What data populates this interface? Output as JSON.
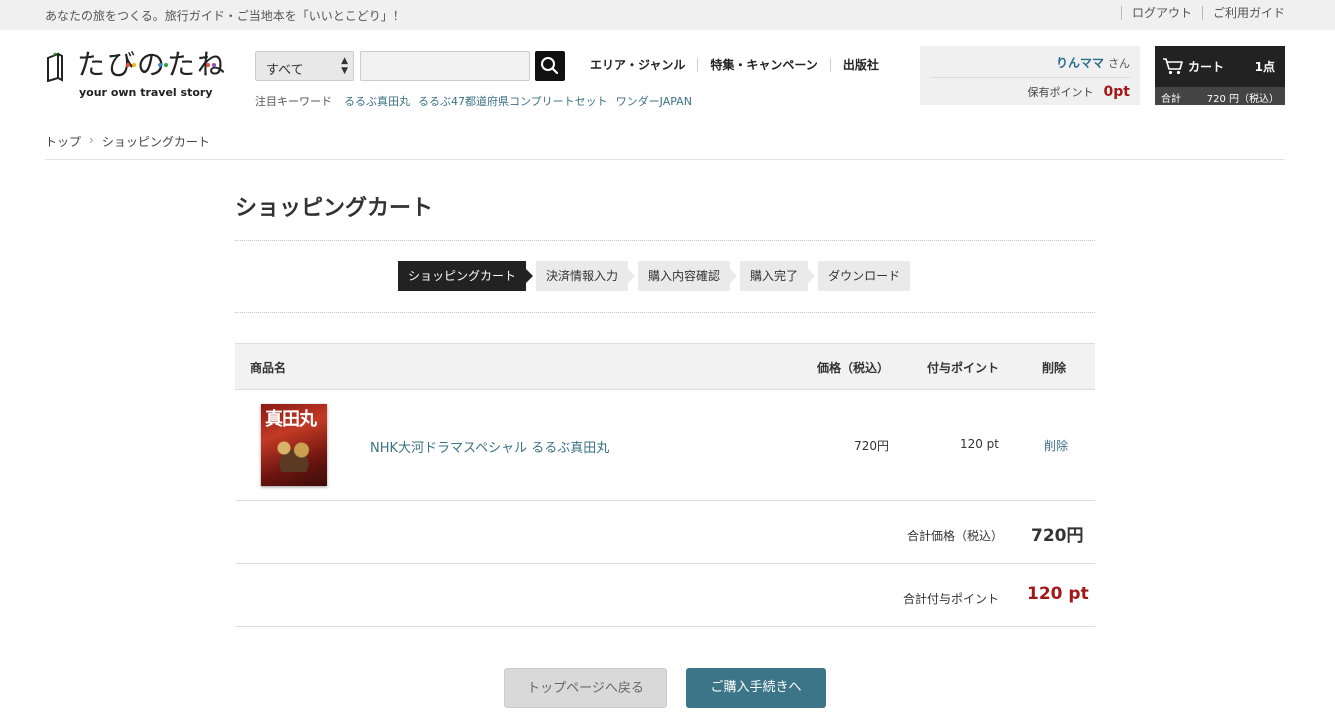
{
  "topbar": {
    "tagline": "あなたの旅をつくる。旅行ガイド・ご当地本を「いいとこどり」！",
    "logout": "ログアウト",
    "guide": "ご利用ガイド"
  },
  "logo": {
    "main": "たびのたね",
    "sub": "your own travel story"
  },
  "search": {
    "category": "すべて",
    "input_value": ""
  },
  "nav": {
    "area": "エリア・ジャンル",
    "feature": "特集・キャンペーン",
    "publisher": "出版社"
  },
  "keywords": {
    "label": "注目キーワード",
    "items": [
      "るるぶ真田丸",
      "るるぶ47都道府県コンプリートセット",
      "ワンダーJAPAN"
    ]
  },
  "user": {
    "name": "りんママ",
    "honorific": "さん",
    "points_label": "保有ポイント",
    "points_value": "0pt"
  },
  "cart": {
    "label": "カート",
    "count": "1点",
    "total_label": "合計",
    "total_value": "720 円（税込）"
  },
  "breadcrumb": {
    "top": "トップ",
    "sep": "›",
    "current": "ショッピングカート"
  },
  "page": {
    "title": "ショッピングカート"
  },
  "steps": [
    "ショッピングカート",
    "決済情報入力",
    "購入内容確認",
    "購入完了",
    "ダウンロード"
  ],
  "table": {
    "headers": {
      "name": "商品名",
      "price": "価格（税込）",
      "points": "付与ポイント",
      "delete": "削除"
    },
    "items": [
      {
        "cover_title": "真田丸",
        "name": "NHK大河ドラマスペシャル るるぶ真田丸",
        "price": "720円",
        "points": "120 pt",
        "delete": "削除"
      }
    ]
  },
  "summary": {
    "total_price_label": "合計価格（税込）",
    "total_price": "720円",
    "total_points_label": "合計付与ポイント",
    "total_points": "120 pt"
  },
  "buttons": {
    "back": "トップページへ戻る",
    "buy": "ご購入手続きへ"
  },
  "colors": {
    "link": "#3b7286",
    "accent_red": "#a01818",
    "cta": "#3c7587",
    "dark": "#222222"
  }
}
